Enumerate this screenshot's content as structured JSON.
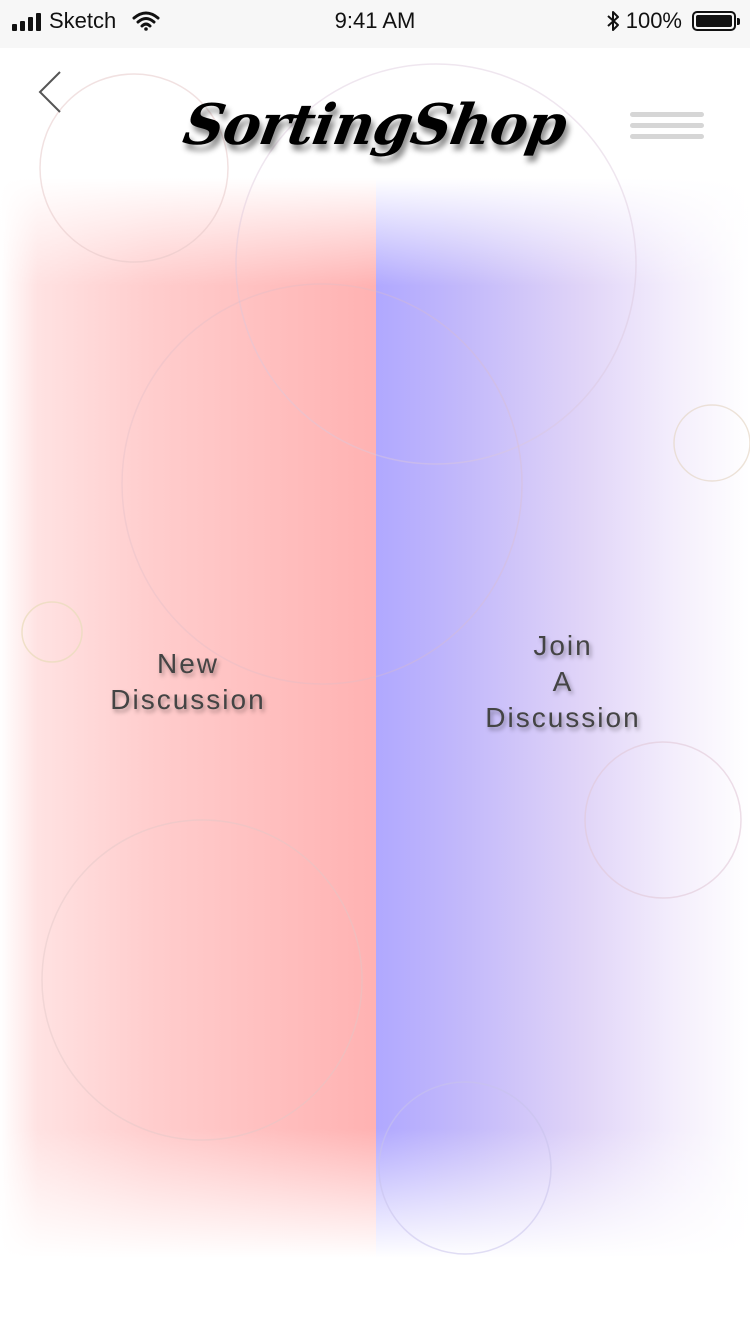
{
  "status_bar": {
    "carrier": "Sketch",
    "time": "9:41 AM",
    "battery_percent": "100%"
  },
  "header": {
    "logo_text": "SortingShop",
    "back_icon": "chevron-left-icon",
    "menu_icon": "hamburger-menu-icon"
  },
  "panels": {
    "new_discussion": {
      "label": "New\nDiscussion",
      "color": "#ffb2b2"
    },
    "join_discussion": {
      "label": "Join\nA\nDiscussion",
      "color": "#b0a8ff"
    }
  }
}
